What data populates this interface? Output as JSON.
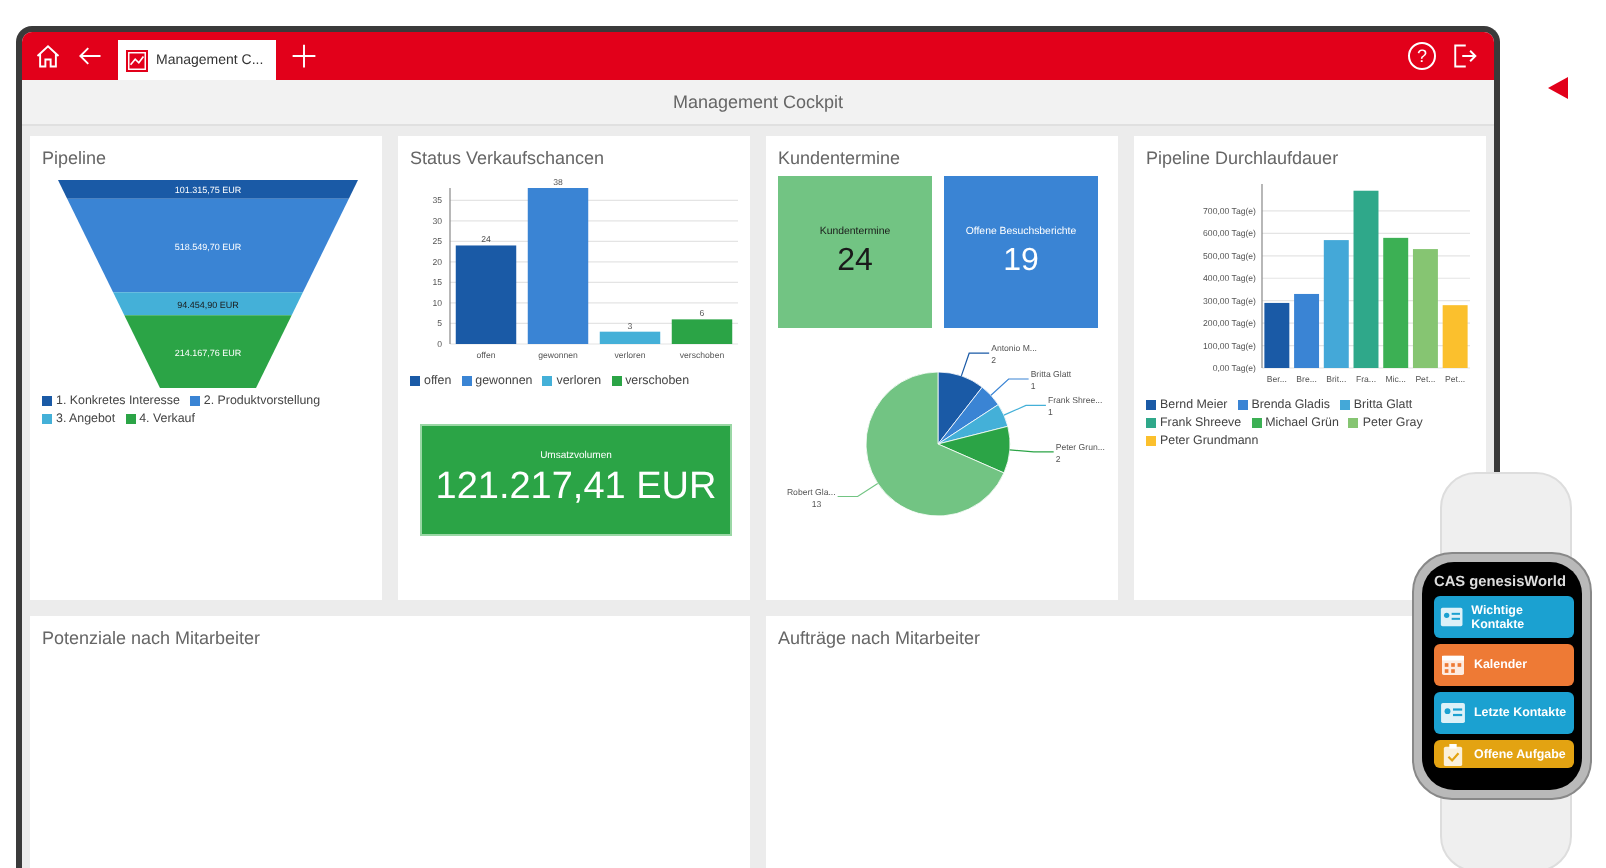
{
  "tabs": [
    {
      "label": "Management C...",
      "selected": true
    }
  ],
  "help_button": "?",
  "page_title": "Management Cockpit",
  "pipeline": {
    "title": "Pipeline",
    "segments": [
      {
        "label": "101.315,75 EUR",
        "color": "#1a5aa6"
      },
      {
        "label": "518.549,70 EUR",
        "color": "#3a84d4"
      },
      {
        "label": "94.454,90 EUR",
        "color": "#44b0d8"
      },
      {
        "label": "214.167,76 EUR",
        "color": "#2ba446"
      }
    ],
    "legend": [
      {
        "label": "1. Konkretes Interesse",
        "color": "#1a5aa6"
      },
      {
        "label": "2. Produktvorstellung",
        "color": "#3a84d4"
      },
      {
        "label": "3. Angebot",
        "color": "#44b0d8"
      },
      {
        "label": "4. Verkauf",
        "color": "#2ba446"
      }
    ]
  },
  "status": {
    "title": "Status Verkaufschancen",
    "chart_data": {
      "type": "bar",
      "categories": [
        "offen",
        "gewonnen",
        "verloren",
        "verschoben"
      ],
      "stacked": true,
      "grid": true,
      "data_labels": true,
      "ylim": [
        0,
        38
      ],
      "yticks": [
        0,
        5,
        10,
        15,
        20,
        25,
        30,
        35
      ],
      "series": [
        {
          "name": "offen",
          "color": "#1a5aa6",
          "values": [
            24,
            null,
            null,
            null
          ]
        },
        {
          "name": "gewonnen",
          "color": "#3a84d4",
          "values": [
            null,
            38,
            null,
            null
          ]
        },
        {
          "name": "verloren",
          "color": "#44b0d8",
          "values": [
            null,
            null,
            3,
            null
          ]
        },
        {
          "name": "verschoben",
          "color": "#2ba446",
          "values": [
            null,
            null,
            null,
            6
          ]
        }
      ]
    },
    "kpi": {
      "label": "Umsatzvolumen",
      "value": "121.217,41 EUR"
    }
  },
  "kundentermine": {
    "title": "Kundentermine",
    "tiles": [
      {
        "label": "Kundentermine",
        "value": "24",
        "color": "#72c483"
      },
      {
        "label": "Offene Besuchsberichte",
        "value": "19",
        "color": "#3a84d4"
      }
    ],
    "chart_data": {
      "type": "pie",
      "data_labels": true,
      "categories": [
        "Antonio M...",
        "Britta Glatt",
        "Frank Shree...",
        "Peter Grun...",
        "Robert Gla..."
      ],
      "values": [
        2,
        1,
        1,
        2,
        13
      ],
      "colors": [
        "#1a5aa6",
        "#3a84d4",
        "#44b0d8",
        "#2ba446",
        "#72c483"
      ]
    }
  },
  "durchlauf": {
    "title": "Pipeline Durchlaufdauer",
    "chart_data": {
      "type": "bar",
      "categories": [
        "Ber...",
        "Bre...",
        "Brit...",
        "Fra...",
        "Mic...",
        "Pet...",
        "Pet..."
      ],
      "stacked": true,
      "grid": true,
      "ylim": [
        0,
        820
      ],
      "yticks": [
        {
          "value": 0,
          "label": "0,00 Tag(e)"
        },
        {
          "value": 100,
          "label": "100,00 Tag(e)"
        },
        {
          "value": 200,
          "label": "200,00 Tag(e)"
        },
        {
          "value": 300,
          "label": "300,00 Tag(e)"
        },
        {
          "value": 400,
          "label": "400,00 Tag(e)"
        },
        {
          "value": 500,
          "label": "500,00 Tag(e)"
        },
        {
          "value": 600,
          "label": "600,00 Tag(e)"
        },
        {
          "value": 700,
          "label": "700,00 Tag(e)"
        }
      ],
      "series": [
        {
          "name": "Bernd Meier",
          "color": "#1a5aa6",
          "values": [
            290,
            null,
            null,
            null,
            null,
            null,
            null
          ]
        },
        {
          "name": "Brenda Gladis",
          "color": "#3a84d4",
          "values": [
            null,
            330,
            null,
            null,
            null,
            null,
            null
          ]
        },
        {
          "name": "Britta Glatt",
          "color": "#44a8d8",
          "values": [
            null,
            null,
            570,
            null,
            null,
            null,
            null
          ]
        },
        {
          "name": "Frank Shreeve",
          "color": "#2fa88a",
          "values": [
            null,
            null,
            null,
            790,
            null,
            null,
            null
          ]
        },
        {
          "name": "Michael Grün",
          "color": "#3cb054",
          "values": [
            null,
            null,
            null,
            null,
            580,
            null,
            null
          ]
        },
        {
          "name": "Peter Gray",
          "color": "#86c572",
          "values": [
            null,
            null,
            null,
            null,
            null,
            530,
            null
          ]
        },
        {
          "name": "Peter Grundmann",
          "color": "#fbc02d",
          "values": [
            null,
            null,
            null,
            null,
            null,
            null,
            280
          ]
        }
      ]
    }
  },
  "lower_cards": [
    {
      "title": "Potenziale nach Mitarbeiter"
    },
    {
      "title": "Aufträge nach Mitarbeiter"
    }
  ],
  "watch": {
    "title": "CAS genesisWorld",
    "items": [
      {
        "label": "Wichtige Kontakte",
        "kind": "contact",
        "color": "#1ba1d1"
      },
      {
        "label": "Kalender",
        "kind": "calendar",
        "color": "#ee7a35"
      },
      {
        "label": "Letzte Kontakte",
        "kind": "contact",
        "color": "#1ba1d1"
      },
      {
        "label": "Offene Aufgabe",
        "kind": "task",
        "color": "#e3a312"
      }
    ]
  }
}
